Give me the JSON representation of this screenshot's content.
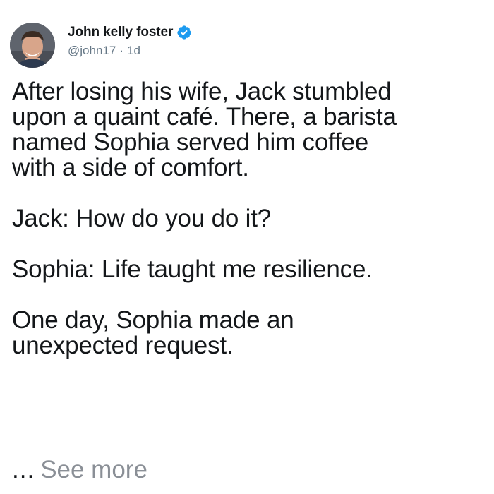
{
  "tweet": {
    "author": {
      "display_name": "John kelly foster",
      "handle": "@john17",
      "separator": "·",
      "age": "1d",
      "verified": true,
      "verified_color": "#1d9bf0"
    },
    "body_paragraphs": [
      "After losing his wife, Jack stumbled\nupon a quaint café. There, a barista\nnamed Sophia served him coffee\nwith a side of comfort.",
      "Jack: How do you do it?",
      "Sophia: Life taught me resilience.",
      "One day, Sophia made an\nunexpected request."
    ],
    "truncation": {
      "ellipsis": "...",
      "see_more_label": "See more"
    }
  },
  "icons": {
    "avatar": "avatar-photo",
    "verified": "verified-badge-icon"
  }
}
